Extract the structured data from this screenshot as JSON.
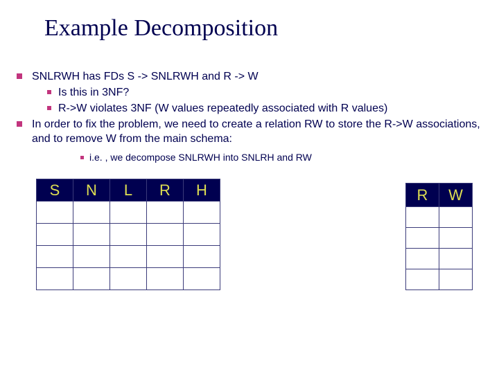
{
  "title": "Example Decomposition",
  "bullets": {
    "b1": "SNLRWH has FDs  S  ->  SNLRWH  and  R  ->  W",
    "b1a": "Is this in 3NF?",
    "b1b": "R->W violates 3NF (W values repeatedly associated with R values)",
    "b2": "In order to fix the problem, we need to create a relation RW to store the R->W associations, and to remove W from the main schema:",
    "b2a": "i.e. , we decompose SNLRWH into SNLRH and RW"
  },
  "table1_headers": [
    "S",
    "N",
    "L",
    "R",
    "H"
  ],
  "table2_headers": [
    "R",
    "W"
  ]
}
